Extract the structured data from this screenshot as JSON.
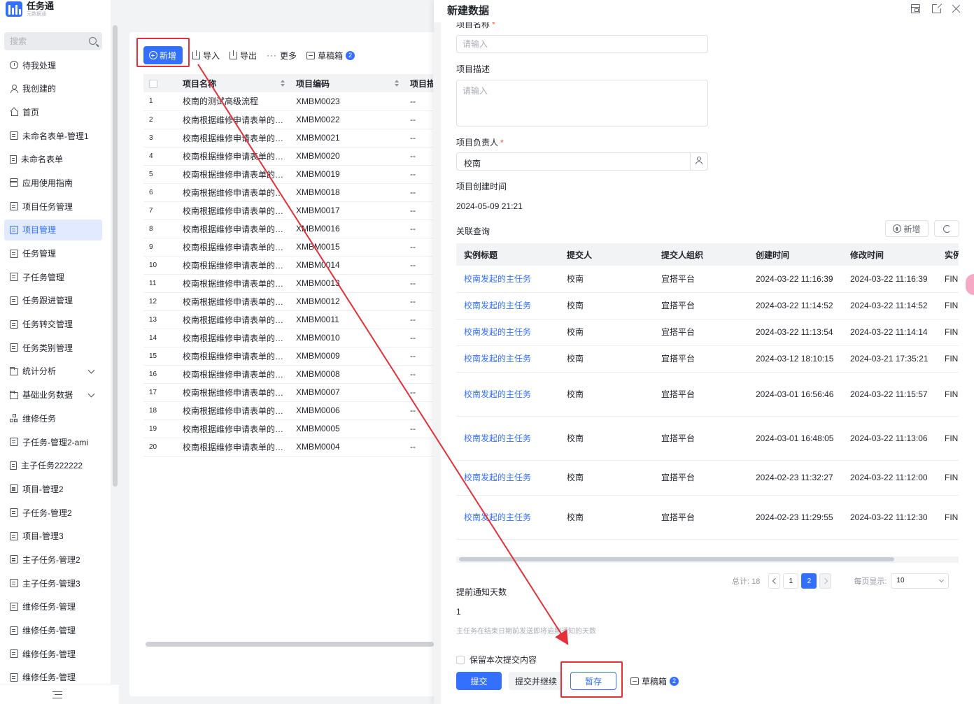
{
  "app": {
    "title": "任务通",
    "subtitle": "元数据通"
  },
  "sidebar": {
    "search_placeholder": "搜索",
    "items": [
      {
        "label": "待我处理",
        "icon": "clock-icon",
        "active": false
      },
      {
        "label": "我创建的",
        "icon": "user-icon",
        "active": false
      },
      {
        "label": "首页",
        "icon": "home-icon",
        "active": false
      },
      {
        "label": "未命名表单-管理1",
        "icon": "form-icon",
        "active": false
      },
      {
        "label": "未命名表单",
        "icon": "document-icon",
        "active": false
      },
      {
        "label": "应用使用指南",
        "icon": "guide-icon",
        "active": false
      },
      {
        "label": "项目任务管理",
        "icon": "form-icon",
        "active": false
      },
      {
        "label": "项目管理",
        "icon": "form-icon",
        "active": true
      },
      {
        "label": "任务管理",
        "icon": "form-icon",
        "active": false
      },
      {
        "label": "子任务管理",
        "icon": "form-icon",
        "active": false
      },
      {
        "label": "任务跟进管理",
        "icon": "form-icon",
        "active": false
      },
      {
        "label": "任务转交管理",
        "icon": "form-icon",
        "active": false
      },
      {
        "label": "任务类别管理",
        "icon": "form-icon",
        "active": false
      },
      {
        "label": "统计分析",
        "icon": "folder-icon",
        "active": false,
        "expandable": true
      },
      {
        "label": "基础业务数据",
        "icon": "folder-icon",
        "active": false,
        "expandable": true
      },
      {
        "label": "维修任务",
        "icon": "tree-icon",
        "active": false
      },
      {
        "label": "子任务-管理2-ami",
        "icon": "form-icon",
        "active": false
      },
      {
        "label": "主子任务222222",
        "icon": "document-icon",
        "active": false
      },
      {
        "label": "项目-管理2",
        "icon": "form-icon",
        "active": false
      },
      {
        "label": "子任务-管理2",
        "icon": "form-icon",
        "active": false
      },
      {
        "label": "项目-管理3",
        "icon": "form-icon",
        "active": false
      },
      {
        "label": "主子任务-管理2",
        "icon": "form-icon",
        "active": false
      },
      {
        "label": "主子任务-管理3",
        "icon": "form-icon",
        "active": false
      },
      {
        "label": "维修任务-管理",
        "icon": "form-icon",
        "active": false
      },
      {
        "label": "维修任务-管理",
        "icon": "form-icon",
        "active": false
      },
      {
        "label": "维修任务-管理",
        "icon": "form-icon",
        "active": false
      },
      {
        "label": "维修任务-管理",
        "icon": "form-icon",
        "active": false
      }
    ]
  },
  "toolbar": {
    "add": "新增",
    "import": "导入",
    "export": "导出",
    "more": "更多",
    "drafts": "草稿箱",
    "drafts_count": "2"
  },
  "list": {
    "columns": [
      "项目名称",
      "项目编码",
      "项目描"
    ],
    "rows": [
      {
        "idx": "1",
        "name": "校南的测试高级流程",
        "code": "XMBM0023",
        "desc": "--"
      },
      {
        "idx": "2",
        "name": "校南根据维修申请表单的日…",
        "code": "XMBM0022",
        "desc": "--"
      },
      {
        "idx": "3",
        "name": "校南根据维修申请表单的日…",
        "code": "XMBM0021",
        "desc": "--"
      },
      {
        "idx": "4",
        "name": "校南根据维修申请表单的日…",
        "code": "XMBM0020",
        "desc": "--"
      },
      {
        "idx": "5",
        "name": "校南根据维修申请表单的日…",
        "code": "XMBM0019",
        "desc": "--"
      },
      {
        "idx": "6",
        "name": "校南根据维修申请表单的日…",
        "code": "XMBM0018",
        "desc": "--"
      },
      {
        "idx": "7",
        "name": "校南根据维修申请表单的日…",
        "code": "XMBM0017",
        "desc": "--"
      },
      {
        "idx": "8",
        "name": "校南根据维修申请表单的日…",
        "code": "XMBM0016",
        "desc": "--"
      },
      {
        "idx": "9",
        "name": "校南根据维修申请表单的日…",
        "code": "XMBM0015",
        "desc": "--"
      },
      {
        "idx": "10",
        "name": "校南根据维修申请表单的日…",
        "code": "XMBM0014",
        "desc": "--"
      },
      {
        "idx": "11",
        "name": "校南根据维修申请表单的日…",
        "code": "XMBM0013",
        "desc": "--"
      },
      {
        "idx": "12",
        "name": "校南根据维修申请表单的日…",
        "code": "XMBM0012",
        "desc": "--"
      },
      {
        "idx": "13",
        "name": "校南根据维修申请表单的日…",
        "code": "XMBM0011",
        "desc": "--"
      },
      {
        "idx": "14",
        "name": "校南根据维修申请表单的日…",
        "code": "XMBM0010",
        "desc": "--"
      },
      {
        "idx": "15",
        "name": "校南根据维修申请表单的日…",
        "code": "XMBM0009",
        "desc": "--"
      },
      {
        "idx": "16",
        "name": "校南根据维修申请表单的日…",
        "code": "XMBM0008",
        "desc": "--"
      },
      {
        "idx": "17",
        "name": "校南根据维修申请表单的日…",
        "code": "XMBM0007",
        "desc": "--"
      },
      {
        "idx": "18",
        "name": "校南根据维修申请表单的日…",
        "code": "XMBM0006",
        "desc": "--"
      },
      {
        "idx": "19",
        "name": "校南根据维修申请表单的日…",
        "code": "XMBM0005",
        "desc": "--"
      },
      {
        "idx": "20",
        "name": "校南根据维修申请表单的日…",
        "code": "XMBM0004",
        "desc": "--"
      }
    ]
  },
  "drawer": {
    "title": "新建数据",
    "form": {
      "name_label": "项目名称",
      "name_placeholder": "请输入",
      "desc_label": "项目描述",
      "desc_placeholder": "请输入",
      "owner_label": "项目负责人",
      "owner_value": "校南",
      "created_label": "项目创建时间",
      "created_value": "2024-05-09 21:21",
      "related_label": "关联查询",
      "related_add": "新增",
      "related_columns": [
        "实例标题",
        "提交人",
        "提交人组织",
        "创建时间",
        "修改时间",
        "实例"
      ],
      "related_rows": [
        {
          "title": "校南发起的主任务",
          "submitter": "校南",
          "org": "宜搭平台",
          "created": "2024-03-22 11:16:39",
          "modified": "2024-03-22 11:16:39",
          "status": "FINI"
        },
        {
          "title": "校南发起的主任务",
          "submitter": "校南",
          "org": "宜搭平台",
          "created": "2024-03-22 11:14:52",
          "modified": "2024-03-22 11:14:52",
          "status": "FINI"
        },
        {
          "title": "校南发起的主任务",
          "submitter": "校南",
          "org": "宜搭平台",
          "created": "2024-03-22 11:13:54",
          "modified": "2024-03-22 11:14:14",
          "status": "FINI"
        },
        {
          "title": "校南发起的主任务",
          "submitter": "校南",
          "org": "宜搭平台",
          "created": "2024-03-12 18:10:15",
          "modified": "2024-03-21 17:35:21",
          "status": "FINI"
        },
        {
          "title": "校南发起的主任务",
          "submitter": "校南",
          "org": "宜搭平台",
          "created": "2024-03-01 16:56:46",
          "modified": "2024-03-22 11:15:57",
          "status": "FINI"
        },
        {
          "title": "校南发起的主任务",
          "submitter": "校南",
          "org": "宜搭平台",
          "created": "2024-03-01 16:48:05",
          "modified": "2024-03-22 11:13:06",
          "status": "FINI"
        },
        {
          "title": "校南发起的主任务",
          "submitter": "校南",
          "org": "宜搭平台",
          "created": "2024-02-23 11:32:27",
          "modified": "2024-03-22 11:12:00",
          "status": "FINI"
        },
        {
          "title": "校南发起的主任务",
          "submitter": "校南",
          "org": "宜搭平台",
          "created": "2024-02-23 11:29:55",
          "modified": "2024-03-22 11:12:30",
          "status": "FINI"
        }
      ],
      "pager": {
        "total": "总计: 18",
        "page1": "1",
        "page2": "2",
        "per_page_label": "每页显示:",
        "per_page_value": "10"
      },
      "notice_label": "提前通知天数",
      "notice_value": "1",
      "notice_hint": "主任务在结束日期前发送即将逾期通知的天数",
      "keep_label": "保留本次提交内容"
    },
    "actions": {
      "submit": "提交",
      "submit_continue": "提交并继续",
      "save_temp": "暂存",
      "drafts": "草稿箱",
      "drafts_count": "2"
    }
  },
  "annotation": {
    "color": "#e5303a"
  }
}
